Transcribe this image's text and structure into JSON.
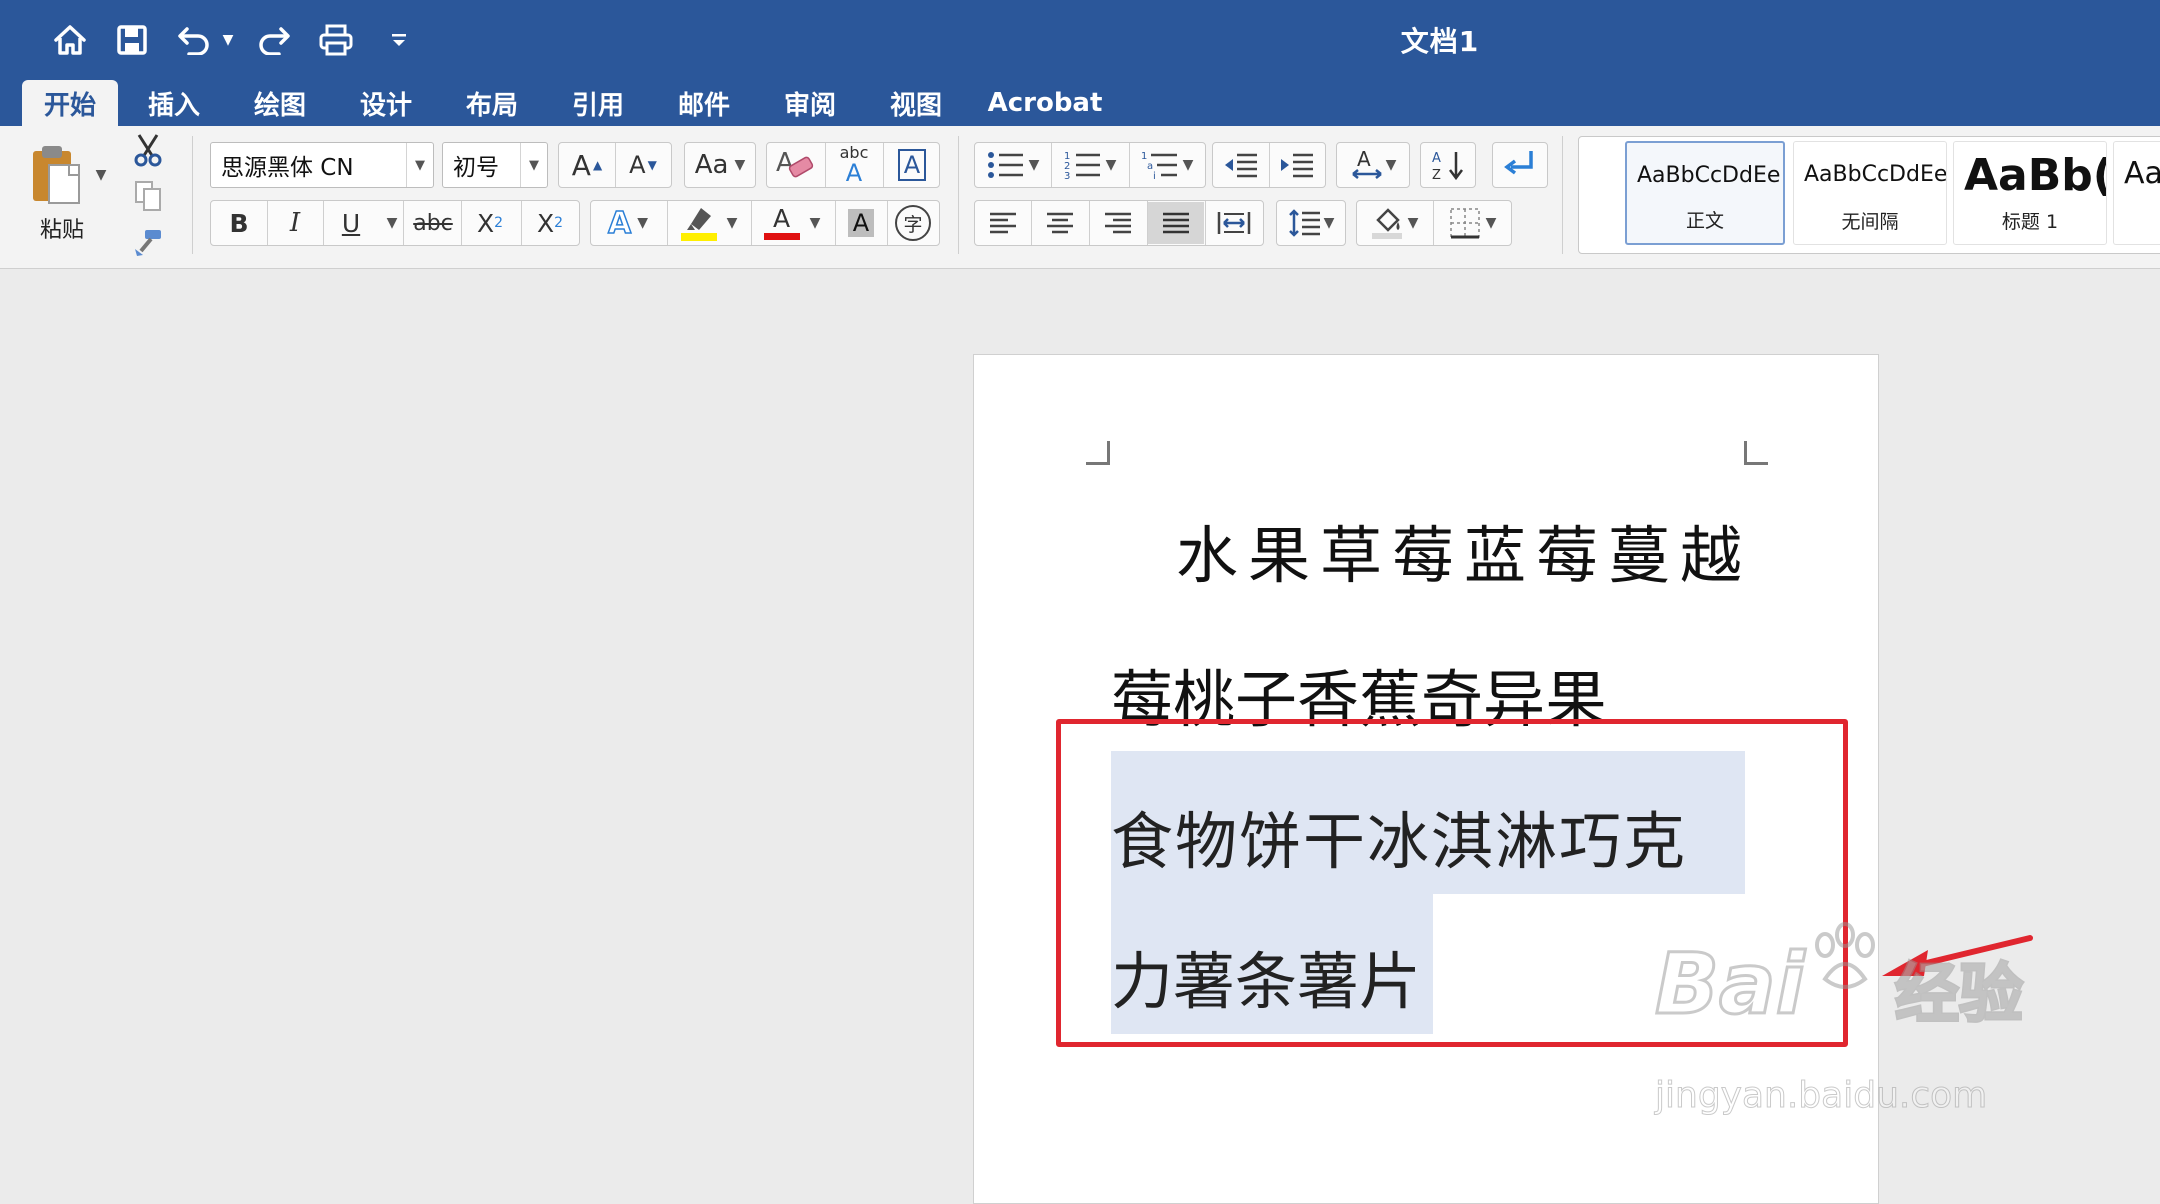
{
  "window": {
    "title": "文档1"
  },
  "quick_access": {
    "icons": [
      "home-icon",
      "save-icon",
      "undo-icon",
      "redo-icon",
      "print-icon",
      "customize-icon"
    ]
  },
  "tabs": [
    {
      "label": "开始",
      "active": true
    },
    {
      "label": "插入"
    },
    {
      "label": "绘图"
    },
    {
      "label": "设计"
    },
    {
      "label": "布局"
    },
    {
      "label": "引用"
    },
    {
      "label": "邮件"
    },
    {
      "label": "审阅"
    },
    {
      "label": "视图"
    },
    {
      "label": "Acrobat"
    }
  ],
  "clipboard": {
    "paste_label": "粘贴"
  },
  "font": {
    "name": "思源黑体 CN",
    "size": "初号",
    "bold": "B",
    "italic": "I",
    "underline": "U",
    "strike": "abc",
    "subscript": "X",
    "superscript": "X",
    "sub_mark": "2",
    "sup_mark": "2",
    "grow": "A",
    "shrink": "A",
    "change_case": "Aa",
    "clear_format_glyph": "A",
    "phonetic_top": "abc",
    "phonetic_bottom": "A",
    "border_glyph": "A",
    "effect_glyph": "A",
    "font_color_glyph": "A",
    "shading_glyph": "A",
    "enclose_glyph": "字"
  },
  "colors": {
    "titlebar": "#2b579a",
    "highlight": "#ffef00",
    "font_color": "#e01010",
    "selection": "#dfe6f3",
    "annotation": "#e0262f"
  },
  "styles": [
    {
      "sample": "AaBbCcDdEe",
      "name": "正文",
      "selected": true
    },
    {
      "sample": "AaBbCcDdEe",
      "name": "无间隔"
    },
    {
      "sample": "AaBb(",
      "name": "标题 1"
    },
    {
      "sample": "Aa",
      "name": ""
    }
  ],
  "document": {
    "lines": [
      "水果草莓蓝莓蔓越",
      "莓桃子香蕉奇异果",
      "食物饼干冰淇淋巧克",
      "力薯条薯片"
    ]
  },
  "watermark": {
    "brand": "Bai",
    "brand_cn": "经验",
    "url": "jingyan.baidu.com"
  }
}
